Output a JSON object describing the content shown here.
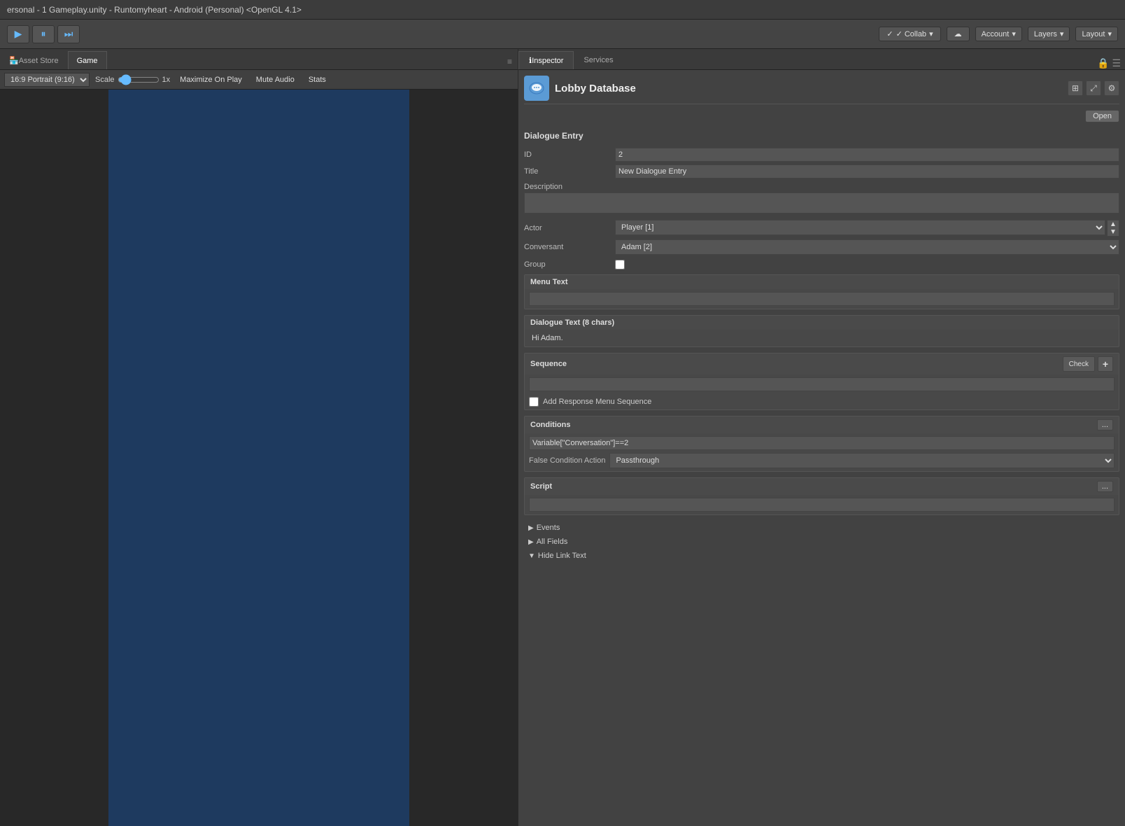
{
  "titlebar": {
    "text": "ersonal - 1 Gameplay.unity - Runtomyheart - Android (Personal) <OpenGL 4.1>"
  },
  "toolbar": {
    "play_label": "▶",
    "pause_label": "⏸",
    "step_label": "⏭",
    "collab_label": "✓ Collab",
    "collab_dropdown": "▾",
    "cloud_label": "☁",
    "account_label": "Account",
    "account_dropdown": "▾",
    "layers_label": "Layers",
    "layers_dropdown": "▾",
    "layout_label": "Layout",
    "layout_dropdown": "▾"
  },
  "game_panel": {
    "tabs": [
      {
        "label": "Asset Store",
        "active": false
      },
      {
        "label": "Game",
        "active": true
      }
    ],
    "toolbar": {
      "resolution": "16:9 Portrait (9:16)",
      "scale_label": "Scale",
      "scale_value": "1x",
      "maximize_label": "Maximize On Play",
      "mute_label": "Mute Audio",
      "stats_label": "Stats"
    }
  },
  "inspector": {
    "tabs": [
      {
        "label": "Inspector",
        "active": true
      },
      {
        "label": "Services",
        "active": false
      }
    ],
    "lobby": {
      "title": "Lobby Database",
      "open_label": "Open"
    },
    "dialogue_entry": {
      "section_title": "Dialogue Entry",
      "id_label": "ID",
      "id_value": "2",
      "title_label": "Title",
      "title_value": "New Dialogue Entry",
      "description_label": "Description",
      "actor_label": "Actor",
      "actor_value": "Player [1]",
      "conversant_label": "Conversant",
      "conversant_value": "Adam [2]",
      "group_label": "Group"
    },
    "menu_text": {
      "header": "Menu Text"
    },
    "dialogue_text": {
      "header": "Dialogue Text (8 chars)",
      "value": "Hi Adam."
    },
    "sequence": {
      "header": "Sequence",
      "check_label": "Check",
      "plus_label": "+",
      "add_response_label": "Add Response Menu Sequence"
    },
    "conditions": {
      "header": "Conditions",
      "dots_label": "...",
      "value": "Variable[\"Conversation\"]==2",
      "false_condition_label": "False Condition Action",
      "false_condition_value": "Passthrough"
    },
    "script": {
      "header": "Script",
      "dots_label": "..."
    },
    "events": {
      "label": "Events"
    },
    "all_fields": {
      "label": "All Fields"
    },
    "hide_link_text": {
      "label": "Hide Link Text"
    }
  }
}
